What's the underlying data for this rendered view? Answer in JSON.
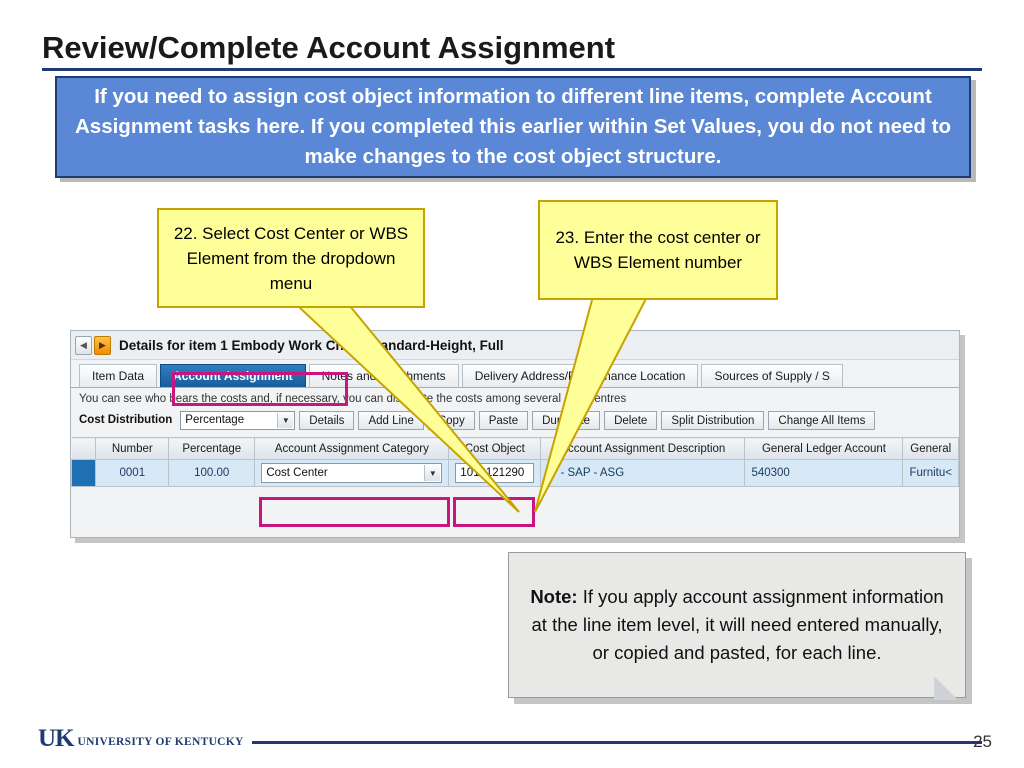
{
  "slide": {
    "title": "Review/Complete Account Assignment",
    "page_number": "25"
  },
  "banner": {
    "text": "If you need to assign cost object information to different line items, complete Account Assignment tasks here. If you completed this earlier within Set Values, you do not need to make changes to the cost object structure.",
    "bg_color": "#5B88D6",
    "border_color": "#1F3B73"
  },
  "callouts": [
    {
      "id": "callout-22",
      "text": "22. Select Cost Center or WBS Element from the dropdown menu",
      "bg_color": "#FFFF99"
    },
    {
      "id": "callout-23",
      "text": "23. Enter the cost center or WBS Element number",
      "bg_color": "#FFFF99"
    }
  ],
  "sap": {
    "header": {
      "prev_icon": "chevron-left-icon",
      "next_icon": "chevron-right-icon",
      "title": "Details for item 1  Embody Work Chair, Standard-Height, Full"
    },
    "tabs": [
      {
        "label": "Item Data",
        "active": false
      },
      {
        "label": "Account Assignment",
        "active": true
      },
      {
        "label": "Notes and Attachments",
        "active": false
      },
      {
        "label": "Delivery Address/Performance Location",
        "active": false
      },
      {
        "label": "Sources of Supply / S",
        "active": false
      }
    ],
    "note": "You can see who bears the costs and, if necessary, you can distribute the costs among several cost centres",
    "toolbar": {
      "cost_distribution_label": "Cost Distribution",
      "cost_distribution_value": "Percentage",
      "buttons": [
        "Details",
        "Add Line",
        "Copy",
        "Paste",
        "Duplicate",
        "Delete",
        "Split Distribution",
        "Change All Items"
      ]
    },
    "table": {
      "columns": [
        "Number",
        "Percentage",
        "Account Assignment Category",
        "Cost Object",
        "Account Assignment Description",
        "General Ledger Account",
        "General"
      ],
      "rows": [
        {
          "number": "0001",
          "percentage": "100.00",
          "account_assignment_category": "Cost Center",
          "cost_object": "1012121290",
          "account_assignment_description": "IT - SAP - ASG",
          "general_ledger_account": "540300",
          "general": "Furnitu<"
        }
      ]
    },
    "highlight_color": "#C9157F"
  },
  "note_box": {
    "label": "Note:",
    "text": " If you apply account assignment information at the line item level, it will need entered manually, or copied and pasted, for each line."
  },
  "footer": {
    "logo_mark": "UK",
    "logo_wordmark": "UNIVERSITY OF KENTUCKY"
  }
}
